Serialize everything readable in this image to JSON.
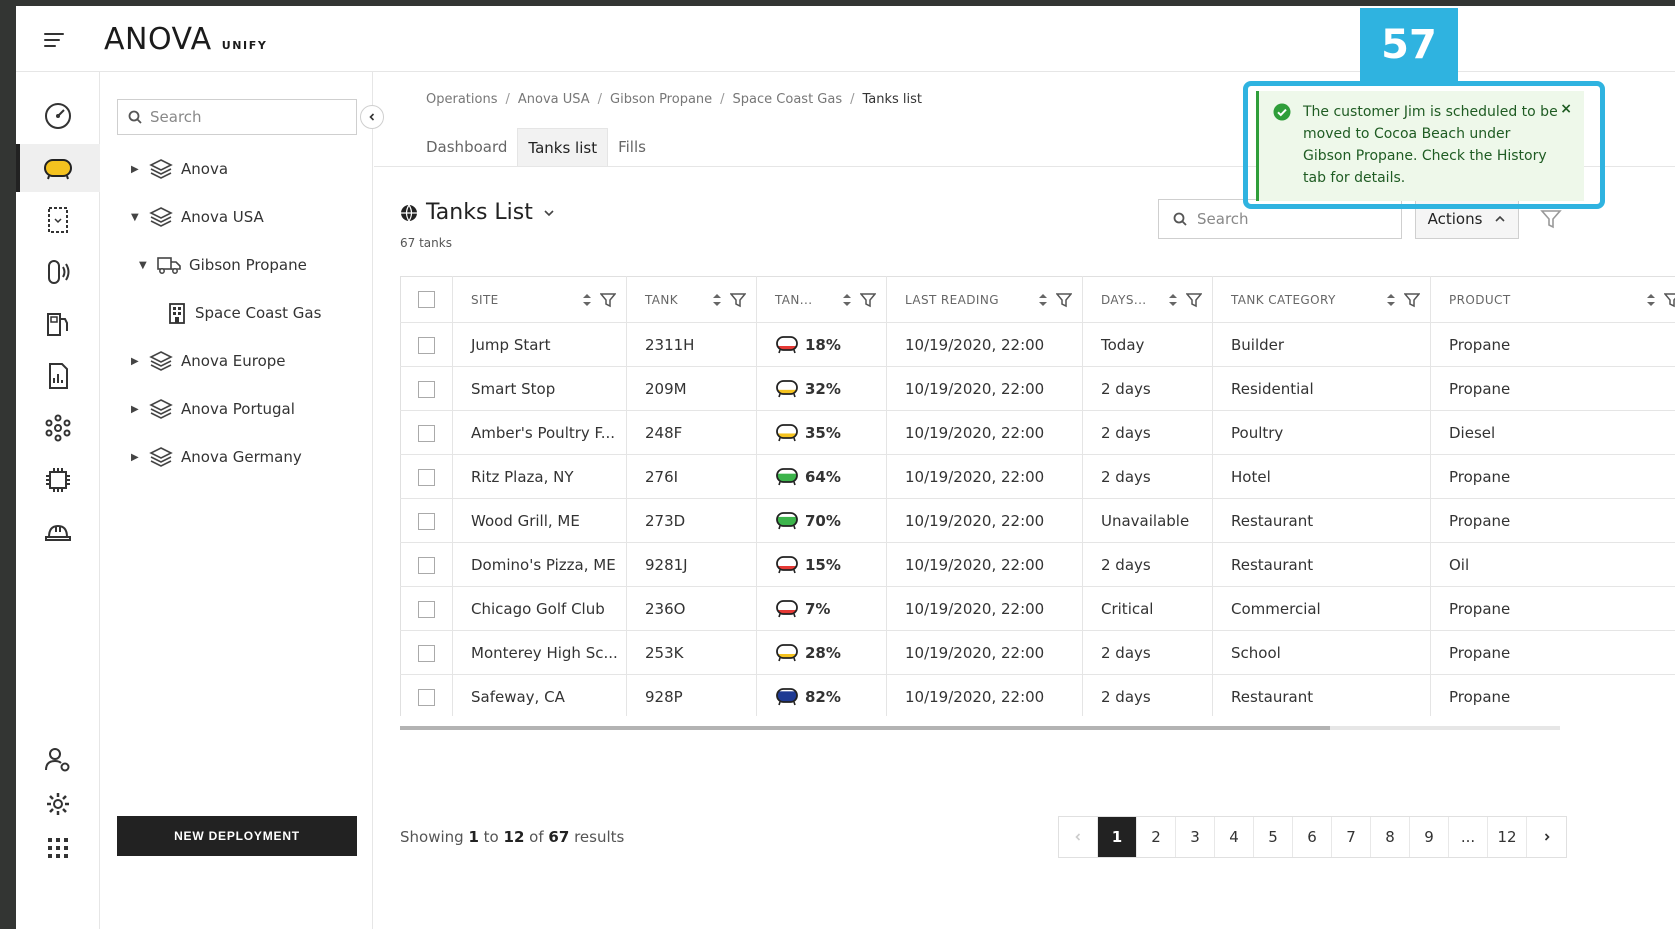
{
  "app": {
    "logo_main": "ANOVA",
    "logo_sub": "UNIFY"
  },
  "tree": {
    "search_placeholder": "Search",
    "nodes": [
      {
        "label": "Anova",
        "expanded": false,
        "icon": "layers-icon"
      },
      {
        "label": "Anova USA",
        "expanded": true,
        "icon": "layers-icon"
      },
      {
        "label": "Gibson Propane",
        "expanded": true,
        "icon": "truck-icon"
      },
      {
        "label": "Space Coast Gas",
        "icon": "building-icon"
      },
      {
        "label": "Anova Europe",
        "expanded": false,
        "icon": "layers-icon"
      },
      {
        "label": "Anova Portugal",
        "expanded": false,
        "icon": "layers-icon"
      },
      {
        "label": "Anova Germany",
        "expanded": false,
        "icon": "layers-icon"
      }
    ],
    "new_deployment_label": "NEW DEPLOYMENT"
  },
  "breadcrumb": [
    "Operations",
    "Anova USA",
    "Gibson Propane",
    "Space Coast Gas",
    "Tanks list"
  ],
  "tabs": [
    {
      "label": "Dashboard",
      "active": false
    },
    {
      "label": "Tanks list",
      "active": true
    },
    {
      "label": "Fills",
      "active": false
    }
  ],
  "list": {
    "title": "Tanks List",
    "count_text": "67 tanks",
    "search_placeholder": "Search",
    "actions_label": "Actions"
  },
  "table": {
    "columns": [
      "SITE",
      "TANK",
      "TAN...",
      "LAST READING",
      "DAYS...",
      "TANK CATEGORY",
      "PRODUCT"
    ],
    "rows": [
      {
        "site": "Jump Start",
        "tank": "2311H",
        "level": "18%",
        "level_color": "#e53935",
        "level_fraction": 0.18,
        "reading": "10/19/2020, 22:00",
        "days": "Today",
        "category": "Builder",
        "product": "Propane"
      },
      {
        "site": "Smart Stop",
        "tank": "209M",
        "level": "32%",
        "level_color": "#f4c21f",
        "level_fraction": 0.32,
        "reading": "10/19/2020, 22:00",
        "days": "2 days",
        "category": "Residential",
        "product": "Propane"
      },
      {
        "site": "Amber's Poultry F...",
        "tank": "248F",
        "level": "35%",
        "level_color": "#f4c21f",
        "level_fraction": 0.35,
        "reading": "10/19/2020, 22:00",
        "days": "2 days",
        "category": "Poultry",
        "product": "Diesel"
      },
      {
        "site": "Ritz Plaza, NY",
        "tank": "276I",
        "level": "64%",
        "level_color": "#3cb44b",
        "level_fraction": 0.64,
        "reading": "10/19/2020, 22:00",
        "days": "2 days",
        "category": "Hotel",
        "product": "Propane"
      },
      {
        "site": "Wood Grill, ME",
        "tank": "273D",
        "level": "70%",
        "level_color": "#3cb44b",
        "level_fraction": 0.7,
        "reading": "10/19/2020, 22:00",
        "days": "Unavailable",
        "category": "Restaurant",
        "product": "Propane"
      },
      {
        "site": "Domino's Pizza, ME",
        "tank": "9281J",
        "level": "15%",
        "level_color": "#e53935",
        "level_fraction": 0.15,
        "reading": "10/19/2020, 22:00",
        "days": "2 days",
        "category": "Restaurant",
        "product": "Oil"
      },
      {
        "site": "Chicago Golf Club",
        "tank": "236O",
        "level": "7%",
        "level_color": "#e53935",
        "level_fraction": 0.07,
        "reading": "10/19/2020, 22:00",
        "days": "Critical",
        "category": "Commercial",
        "product": "Propane"
      },
      {
        "site": "Monterey High Sc...",
        "tank": "253K",
        "level": "28%",
        "level_color": "#f4c21f",
        "level_fraction": 0.28,
        "reading": "10/19/2020, 22:00",
        "days": "2 days",
        "category": "School",
        "product": "Propane"
      },
      {
        "site": "Safeway, CA",
        "tank": "928P",
        "level": "82%",
        "level_color": "#1f3a93",
        "level_fraction": 0.82,
        "reading": "10/19/2020, 22:00",
        "days": "2 days",
        "category": "Restaurant",
        "product": "Propane"
      }
    ]
  },
  "pagination": {
    "showing_prefix": "Showing",
    "from": "1",
    "to_word": "to",
    "to": "12",
    "of_word": "of",
    "total": "67",
    "suffix": "results",
    "pages": [
      "1",
      "2",
      "3",
      "4",
      "5",
      "6",
      "7",
      "8",
      "9"
    ],
    "ellipsis": "...",
    "last_page": "12",
    "current": "1"
  },
  "toast": {
    "message": "The customer Jim is scheduled to be moved to Cocoa Beach under Gibson Propane. Check the History tab for details.",
    "close": "×",
    "color": "#2f9e3a"
  },
  "badge": {
    "number": "57"
  },
  "colors": {
    "highlight": "#2fb3e0",
    "dark": "#222222"
  }
}
